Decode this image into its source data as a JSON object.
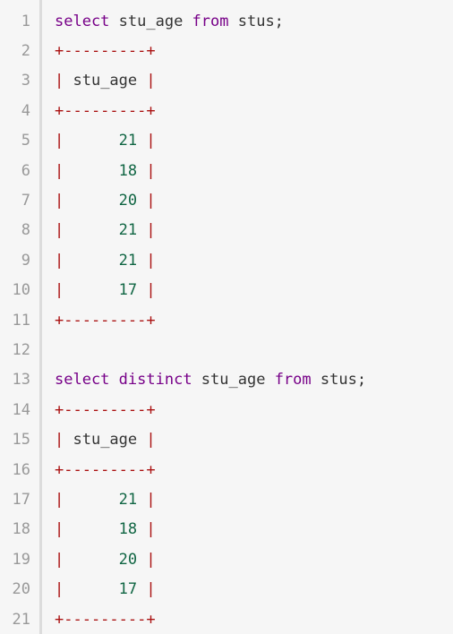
{
  "colors": {
    "background": "#f6f6f6",
    "keyword": "#770088",
    "border": "#aa1111",
    "number": "#116644",
    "line_number": "#999999"
  },
  "lines": [
    {
      "n": "1",
      "tokens": [
        {
          "t": "select",
          "c": "kw"
        },
        {
          "t": " stu_age ",
          "c": "p"
        },
        {
          "t": "from",
          "c": "kw"
        },
        {
          "t": " stus;",
          "c": "p"
        }
      ]
    },
    {
      "n": "2",
      "tokens": [
        {
          "t": "+---------+",
          "c": "border"
        }
      ]
    },
    {
      "n": "3",
      "tokens": [
        {
          "t": "|",
          "c": "border"
        },
        {
          "t": " stu_age ",
          "c": "p"
        },
        {
          "t": "|",
          "c": "border"
        }
      ]
    },
    {
      "n": "4",
      "tokens": [
        {
          "t": "+---------+",
          "c": "border"
        }
      ]
    },
    {
      "n": "5",
      "tokens": [
        {
          "t": "|",
          "c": "border"
        },
        {
          "t": "      ",
          "c": "p"
        },
        {
          "t": "21",
          "c": "num"
        },
        {
          "t": " ",
          "c": "p"
        },
        {
          "t": "|",
          "c": "border"
        }
      ]
    },
    {
      "n": "6",
      "tokens": [
        {
          "t": "|",
          "c": "border"
        },
        {
          "t": "      ",
          "c": "p"
        },
        {
          "t": "18",
          "c": "num"
        },
        {
          "t": " ",
          "c": "p"
        },
        {
          "t": "|",
          "c": "border"
        }
      ]
    },
    {
      "n": "7",
      "tokens": [
        {
          "t": "|",
          "c": "border"
        },
        {
          "t": "      ",
          "c": "p"
        },
        {
          "t": "20",
          "c": "num"
        },
        {
          "t": " ",
          "c": "p"
        },
        {
          "t": "|",
          "c": "border"
        }
      ]
    },
    {
      "n": "8",
      "tokens": [
        {
          "t": "|",
          "c": "border"
        },
        {
          "t": "      ",
          "c": "p"
        },
        {
          "t": "21",
          "c": "num"
        },
        {
          "t": " ",
          "c": "p"
        },
        {
          "t": "|",
          "c": "border"
        }
      ]
    },
    {
      "n": "9",
      "tokens": [
        {
          "t": "|",
          "c": "border"
        },
        {
          "t": "      ",
          "c": "p"
        },
        {
          "t": "21",
          "c": "num"
        },
        {
          "t": " ",
          "c": "p"
        },
        {
          "t": "|",
          "c": "border"
        }
      ]
    },
    {
      "n": "10",
      "tokens": [
        {
          "t": "|",
          "c": "border"
        },
        {
          "t": "      ",
          "c": "p"
        },
        {
          "t": "17",
          "c": "num"
        },
        {
          "t": " ",
          "c": "p"
        },
        {
          "t": "|",
          "c": "border"
        }
      ]
    },
    {
      "n": "11",
      "tokens": [
        {
          "t": "+---------+",
          "c": "border"
        }
      ]
    },
    {
      "n": "12",
      "tokens": []
    },
    {
      "n": "13",
      "tokens": [
        {
          "t": "select",
          "c": "kw"
        },
        {
          "t": " ",
          "c": "p"
        },
        {
          "t": "distinct",
          "c": "kw"
        },
        {
          "t": " stu_age ",
          "c": "p"
        },
        {
          "t": "from",
          "c": "kw"
        },
        {
          "t": " stus;",
          "c": "p"
        }
      ]
    },
    {
      "n": "14",
      "tokens": [
        {
          "t": "+---------+",
          "c": "border"
        }
      ]
    },
    {
      "n": "15",
      "tokens": [
        {
          "t": "|",
          "c": "border"
        },
        {
          "t": " stu_age ",
          "c": "p"
        },
        {
          "t": "|",
          "c": "border"
        }
      ]
    },
    {
      "n": "16",
      "tokens": [
        {
          "t": "+---------+",
          "c": "border"
        }
      ]
    },
    {
      "n": "17",
      "tokens": [
        {
          "t": "|",
          "c": "border"
        },
        {
          "t": "      ",
          "c": "p"
        },
        {
          "t": "21",
          "c": "num"
        },
        {
          "t": " ",
          "c": "p"
        },
        {
          "t": "|",
          "c": "border"
        }
      ]
    },
    {
      "n": "18",
      "tokens": [
        {
          "t": "|",
          "c": "border"
        },
        {
          "t": "      ",
          "c": "p"
        },
        {
          "t": "18",
          "c": "num"
        },
        {
          "t": " ",
          "c": "p"
        },
        {
          "t": "|",
          "c": "border"
        }
      ]
    },
    {
      "n": "19",
      "tokens": [
        {
          "t": "|",
          "c": "border"
        },
        {
          "t": "      ",
          "c": "p"
        },
        {
          "t": "20",
          "c": "num"
        },
        {
          "t": " ",
          "c": "p"
        },
        {
          "t": "|",
          "c": "border"
        }
      ]
    },
    {
      "n": "20",
      "tokens": [
        {
          "t": "|",
          "c": "border"
        },
        {
          "t": "      ",
          "c": "p"
        },
        {
          "t": "17",
          "c": "num"
        },
        {
          "t": " ",
          "c": "p"
        },
        {
          "t": "|",
          "c": "border"
        }
      ]
    },
    {
      "n": "21",
      "tokens": [
        {
          "t": "+---------+",
          "c": "border"
        }
      ]
    }
  ]
}
